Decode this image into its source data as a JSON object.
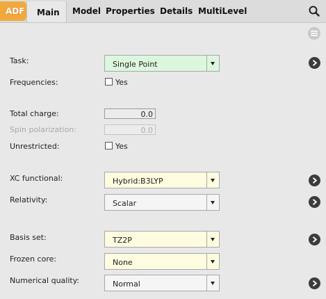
{
  "tabs": {
    "adf": "ADF",
    "main": "Main",
    "model": "Model",
    "properties": "Properties",
    "details": "Details",
    "multilevel": "MultiLevel"
  },
  "form": {
    "task": {
      "label": "Task:",
      "value": "Single Point"
    },
    "frequencies": {
      "label": "Frequencies:",
      "option": "Yes",
      "checked": false
    },
    "total_charge": {
      "label": "Total charge:",
      "value": "0.0"
    },
    "spin_polarization": {
      "label": "Spin polarization:",
      "value": "0.0"
    },
    "unrestricted": {
      "label": "Unrestricted:",
      "option": "Yes",
      "checked": false
    },
    "xc_functional": {
      "label": "XC functional:",
      "value": "Hybrid:B3LYP"
    },
    "relativity": {
      "label": "Relativity:",
      "value": "Scalar"
    },
    "basis_set": {
      "label": "Basis set:",
      "value": "TZ2P"
    },
    "frozen_core": {
      "label": "Frozen core:",
      "value": "None"
    },
    "numerical_quality": {
      "label": "Numerical quality:",
      "value": "Normal"
    }
  },
  "icons": {
    "search": "search-icon",
    "panel_menu": "menu-icon",
    "go": "chevron-right-icon"
  },
  "colors": {
    "adf_tab": "#f2a93b",
    "task_select_bg": "#dcf7dd",
    "highlight_select_bg": "#fdfbe0",
    "go_button": "#3c3c3c"
  }
}
